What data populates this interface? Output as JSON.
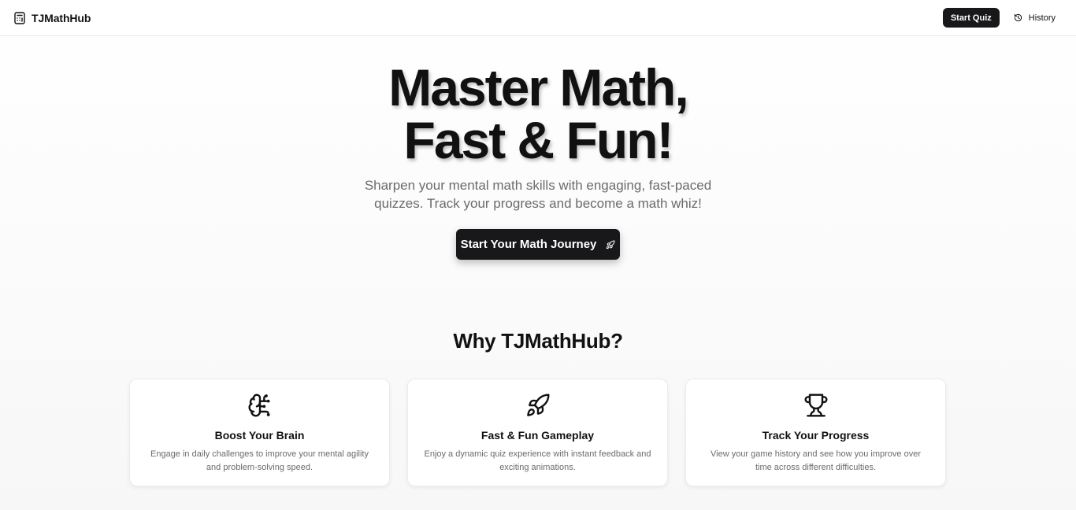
{
  "nav": {
    "brand": "TJMathHub",
    "brand_icon": "calculator-icon",
    "start_quiz": "Start Quiz",
    "history": "History",
    "history_icon": "history-icon"
  },
  "hero": {
    "title_line1": "Master Math,",
    "title_line2": "Fast & Fun!",
    "subtitle": "Sharpen your mental math skills with engaging, fast-paced quizzes. Track your progress and become a math whiz!",
    "cta": "Start Your Math Journey",
    "cta_icon": "rocket-icon"
  },
  "why": {
    "title": "Why TJMathHub?",
    "features": [
      {
        "icon": "brain-icon",
        "title": "Boost Your Brain",
        "description": "Engage in daily challenges to improve your mental agility and problem-solving speed."
      },
      {
        "icon": "rocket-icon",
        "title": "Fast & Fun Gameplay",
        "description": "Enjoy a dynamic quiz experience with instant feedback and exciting animations."
      },
      {
        "icon": "trophy-icon",
        "title": "Track Your Progress",
        "description": "View your game history and see how you improve over time across different difficulties."
      }
    ]
  },
  "colors": {
    "primary": "#18181b",
    "muted_text": "#6b6b6b",
    "border": "#e6e6e6"
  }
}
